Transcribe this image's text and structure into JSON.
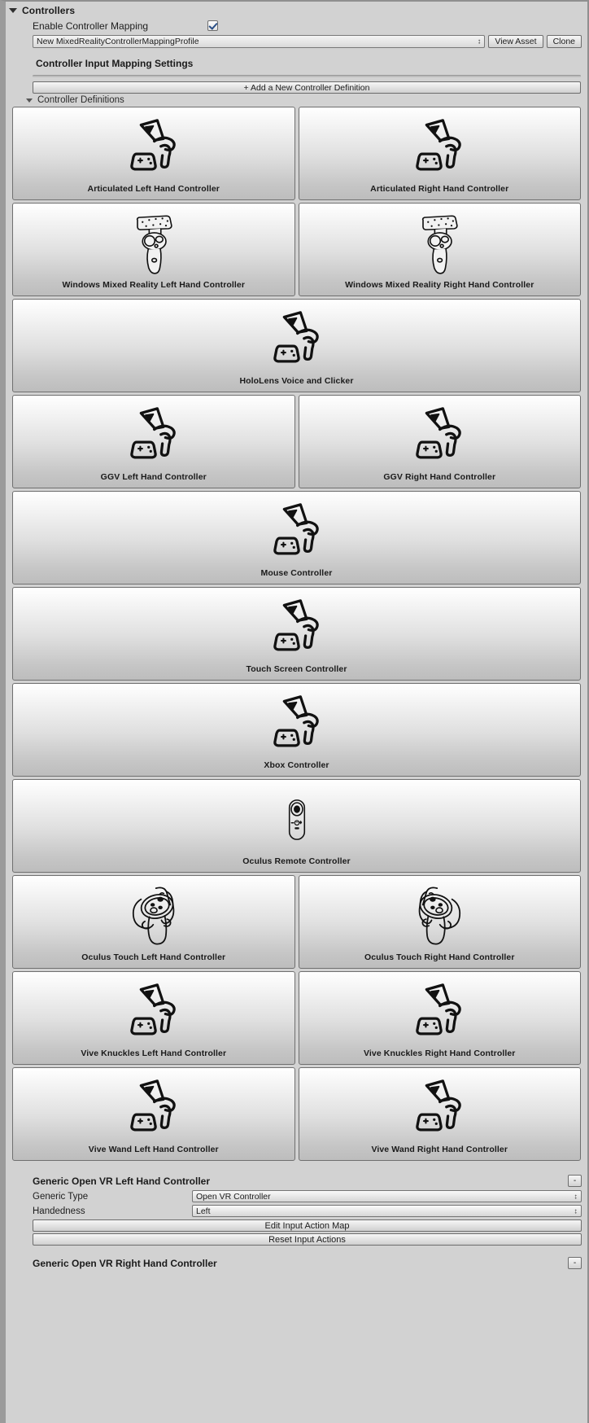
{
  "header": {
    "foldout_title": "Controllers",
    "enable_label": "Enable Controller Mapping",
    "enable_checked": true,
    "profile_value": "New MixedRealityControllerMappingProfile",
    "view_asset_label": "View Asset",
    "clone_label": "Clone",
    "section_title": "Controller Input Mapping Settings",
    "add_definition_label": "+ Add a New Controller Definition",
    "definitions_foldout": "Controller Definitions"
  },
  "colors": {
    "panel_bg": "#d2d2d2",
    "card_top": "#ffffff",
    "card_bottom": "#bdbdbd",
    "border": "#6f6f6f",
    "text": "#1a1a1a",
    "check_accent": "#2a4f86"
  },
  "controller_rows": [
    {
      "cards": [
        {
          "label": "Articulated Left Hand Controller",
          "icon": "generic-controller-icon",
          "mirrored": false
        },
        {
          "label": "Articulated Right Hand Controller",
          "icon": "generic-controller-icon",
          "mirrored": false
        }
      ]
    },
    {
      "cards": [
        {
          "label": "Windows Mixed Reality Left Hand Controller",
          "icon": "wmr-controller-icon",
          "mirrored": false
        },
        {
          "label": "Windows Mixed Reality Right Hand Controller",
          "icon": "wmr-controller-icon",
          "mirrored": false
        }
      ]
    },
    {
      "cards": [
        {
          "label": "HoloLens Voice and Clicker",
          "icon": "generic-controller-icon",
          "mirrored": false
        }
      ]
    },
    {
      "cards": [
        {
          "label": "GGV Left Hand Controller",
          "icon": "generic-controller-icon",
          "mirrored": false
        },
        {
          "label": "GGV Right Hand Controller",
          "icon": "generic-controller-icon",
          "mirrored": false
        }
      ]
    },
    {
      "cards": [
        {
          "label": "Mouse Controller",
          "icon": "generic-controller-icon",
          "mirrored": false
        }
      ]
    },
    {
      "cards": [
        {
          "label": "Touch Screen Controller",
          "icon": "generic-controller-icon",
          "mirrored": false
        }
      ]
    },
    {
      "cards": [
        {
          "label": "Xbox Controller",
          "icon": "generic-controller-icon",
          "mirrored": false
        }
      ]
    },
    {
      "cards": [
        {
          "label": "Oculus Remote Controller",
          "icon": "oculus-remote-icon",
          "mirrored": false
        }
      ]
    },
    {
      "cards": [
        {
          "label": "Oculus Touch Left Hand Controller",
          "icon": "oculus-touch-icon",
          "mirrored": false
        },
        {
          "label": "Oculus Touch Right Hand Controller",
          "icon": "oculus-touch-icon",
          "mirrored": true
        }
      ]
    },
    {
      "cards": [
        {
          "label": "Vive Knuckles Left Hand Controller",
          "icon": "generic-controller-icon",
          "mirrored": false
        },
        {
          "label": "Vive Knuckles Right Hand Controller",
          "icon": "generic-controller-icon",
          "mirrored": false
        }
      ]
    },
    {
      "cards": [
        {
          "label": "Vive Wand Left Hand Controller",
          "icon": "generic-controller-icon",
          "mirrored": false
        },
        {
          "label": "Vive Wand Right Hand Controller",
          "icon": "generic-controller-icon",
          "mirrored": false
        }
      ]
    }
  ],
  "details": [
    {
      "title": "Generic Open VR Left Hand Controller",
      "remove_label": "-",
      "generic_type_label": "Generic Type",
      "generic_type_value": "Open VR Controller",
      "handedness_label": "Handedness",
      "handedness_value": "Left",
      "edit_map_label": "Edit Input Action Map",
      "reset_actions_label": "Reset Input Actions"
    },
    {
      "title": "Generic Open VR Right Hand Controller",
      "remove_label": "-"
    }
  ]
}
